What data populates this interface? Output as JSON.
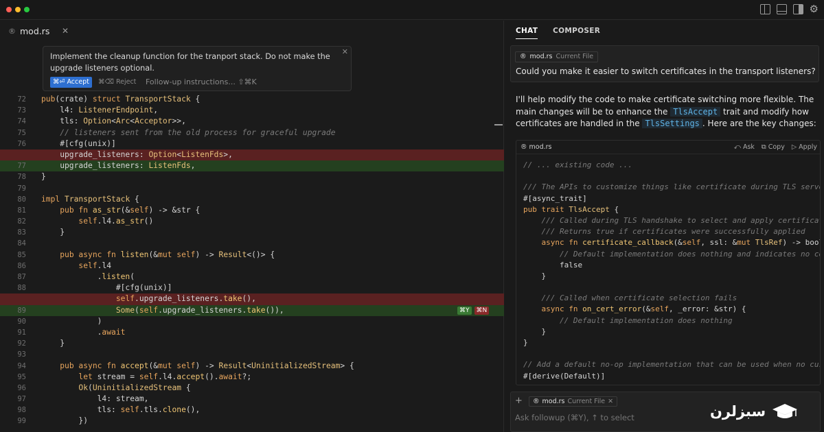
{
  "window": {
    "dots": [
      "#ff5f57",
      "#febc2e",
      "#28c840"
    ]
  },
  "editor": {
    "tab_label": "mod.rs",
    "prompt": {
      "text": "Implement the cleanup function for the tranport stack. Do not make the upgrade listeners optional.",
      "accept_label": "⌘⏎ Accept",
      "reject_label": "⌘⌫ Reject",
      "followup_label": "Follow-up instructions... ⇧⌘K"
    },
    "inline_badges": {
      "accept": "⌘Y",
      "reject": "⌘N"
    }
  },
  "chat": {
    "tabs": [
      "CHAT",
      "COMPOSER"
    ],
    "user_message": {
      "file": "mod.rs",
      "file_tag": "Current File",
      "text": "Could you make it easier to switch certificates in the transport listeners?"
    },
    "assistant": {
      "p1": "I'll help modify the code to make certificate switching more flexible. The main changes will be to enhance the ",
      "code1": "TlsAccept",
      "p2": " trait and modify how certificates are handled in the ",
      "code2": "TlsSettings",
      "p3": ". Here are the key changes:"
    },
    "codeblock": {
      "file": "mod.rs",
      "ask_label": "Ask",
      "copy_label": "Copy",
      "apply_label": "Apply"
    },
    "composer": {
      "file": "mod.rs",
      "file_tag": "Current File",
      "placeholder": "Ask followup (⌘Y), ↑ to select"
    }
  },
  "brand_text": "سبزلرن"
}
